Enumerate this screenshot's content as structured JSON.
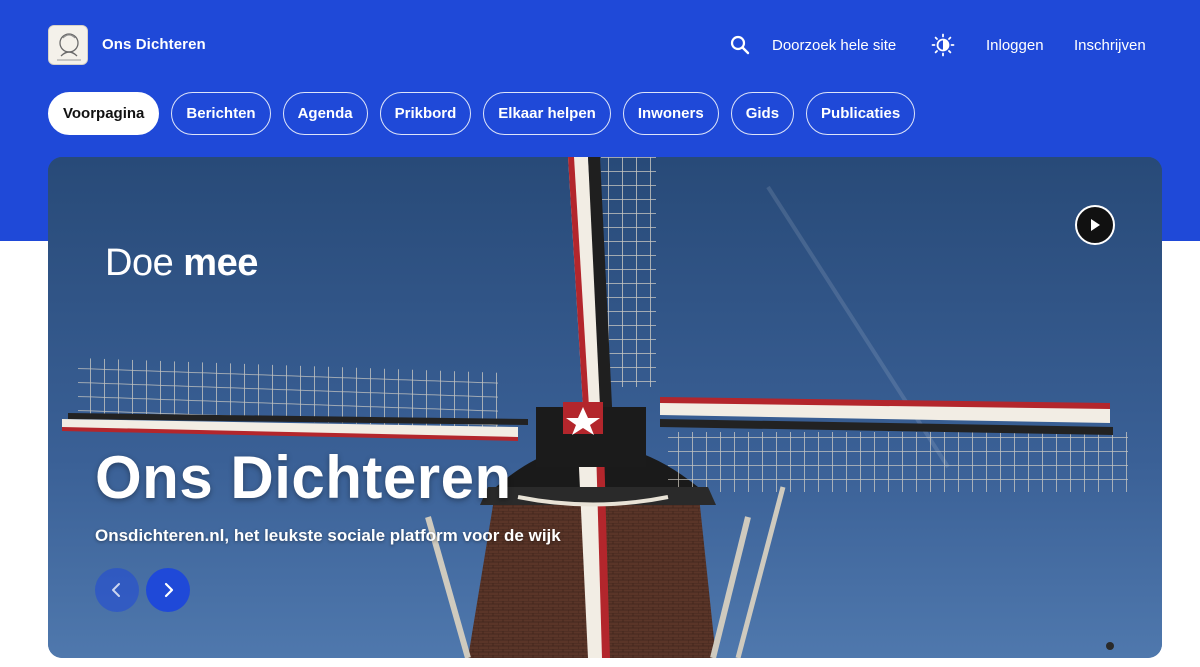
{
  "header": {
    "site_name": "Ons Dichteren",
    "search_label": "Doorzoek hele site",
    "login": "Inloggen",
    "signup": "Inschrijven"
  },
  "nav": {
    "items": [
      {
        "label": "Voorpagina",
        "active": true
      },
      {
        "label": "Berichten"
      },
      {
        "label": "Agenda"
      },
      {
        "label": "Prikbord"
      },
      {
        "label": "Elkaar helpen"
      },
      {
        "label": "Inwoners"
      },
      {
        "label": "Gids"
      },
      {
        "label": "Publicaties"
      }
    ]
  },
  "hero": {
    "kicker_light": "Doe",
    "kicker_bold": "mee",
    "title": "Ons Dichteren",
    "subtitle": "Onsdichteren.nl, het leukste sociale platform voor de wijk"
  },
  "icons": {
    "search": "search-icon",
    "theme": "sun-icon",
    "play": "play-icon",
    "prev": "chevron-left-icon",
    "next": "chevron-right-icon"
  },
  "colors": {
    "brand": "#1f49d8",
    "sky": "#3b5f8f",
    "text_on_brand": "#ffffff"
  }
}
